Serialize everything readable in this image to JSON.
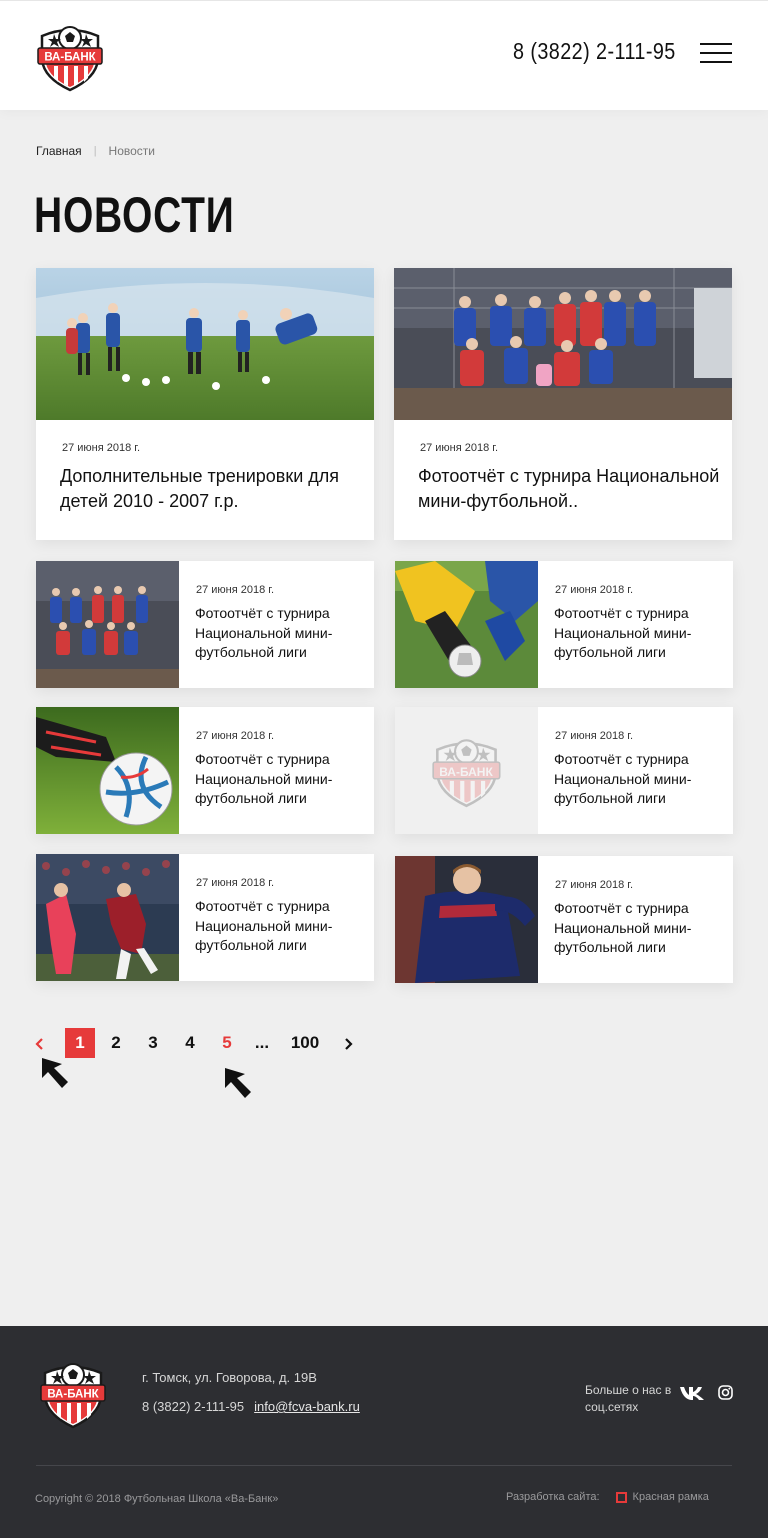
{
  "header": {
    "logo_text": "ВА-БАНК",
    "phone": "8 (3822) 2-111-95",
    "menu_icon": "hamburger-icon"
  },
  "breadcrumb": {
    "home": "Главная",
    "current": "Новости"
  },
  "page_title": "НОВОСТИ",
  "news_featured": [
    {
      "date": "27 июня 2018 г.",
      "title": "Дополнительные тренировки для детей 2010 - 2007 г.р."
    },
    {
      "date": "27 июня 2018 г.",
      "title": "Фотоотчёт с турнира Национальной мини-футбольной.."
    }
  ],
  "news_list": [
    {
      "date": "27 июня 2018 г.",
      "title": "Фотоотчёт с турнира Национальной мини-футбольной лиги"
    },
    {
      "date": "27 июня 2018 г.",
      "title": "Фотоотчёт с турнира Национальной мини-футбольной лиги"
    },
    {
      "date": "27 июня 2018 г.",
      "title": "Фотоотчёт с турнира Национальной мини-футбольной лиги"
    },
    {
      "date": "27 июня 2018 г.",
      "title": "Фотоотчёт с турнира Национальной мини-футбольной лиги"
    },
    {
      "date": "27 июня 2018 г.",
      "title": "Фотоотчёт с турнира Национальной мини-футбольной лиги"
    },
    {
      "date": "27 июня 2018 г.",
      "title": "Фотоотчёт с турнира Национальной мини-футбольной лиги"
    }
  ],
  "pagination": {
    "pages": [
      "1",
      "2",
      "3",
      "4",
      "5",
      "...",
      "100"
    ],
    "current": "1"
  },
  "footer": {
    "address": "г. Томск, ул. Говорова, д. 19В",
    "phone": "8 (3822) 2-111-95",
    "email": "info@fcva-bank.ru",
    "social_text": "Больше о нас в соц.сетях",
    "copyright": "Copyright © 2018 Футбольная Школа «Ва-Банк»",
    "dev_label": "Разработка сайта:",
    "dev_name": "Красная рамка"
  },
  "colors": {
    "accent": "#e63a3a",
    "footer_bg": "#2d2e32",
    "page_bg": "#efefef"
  }
}
